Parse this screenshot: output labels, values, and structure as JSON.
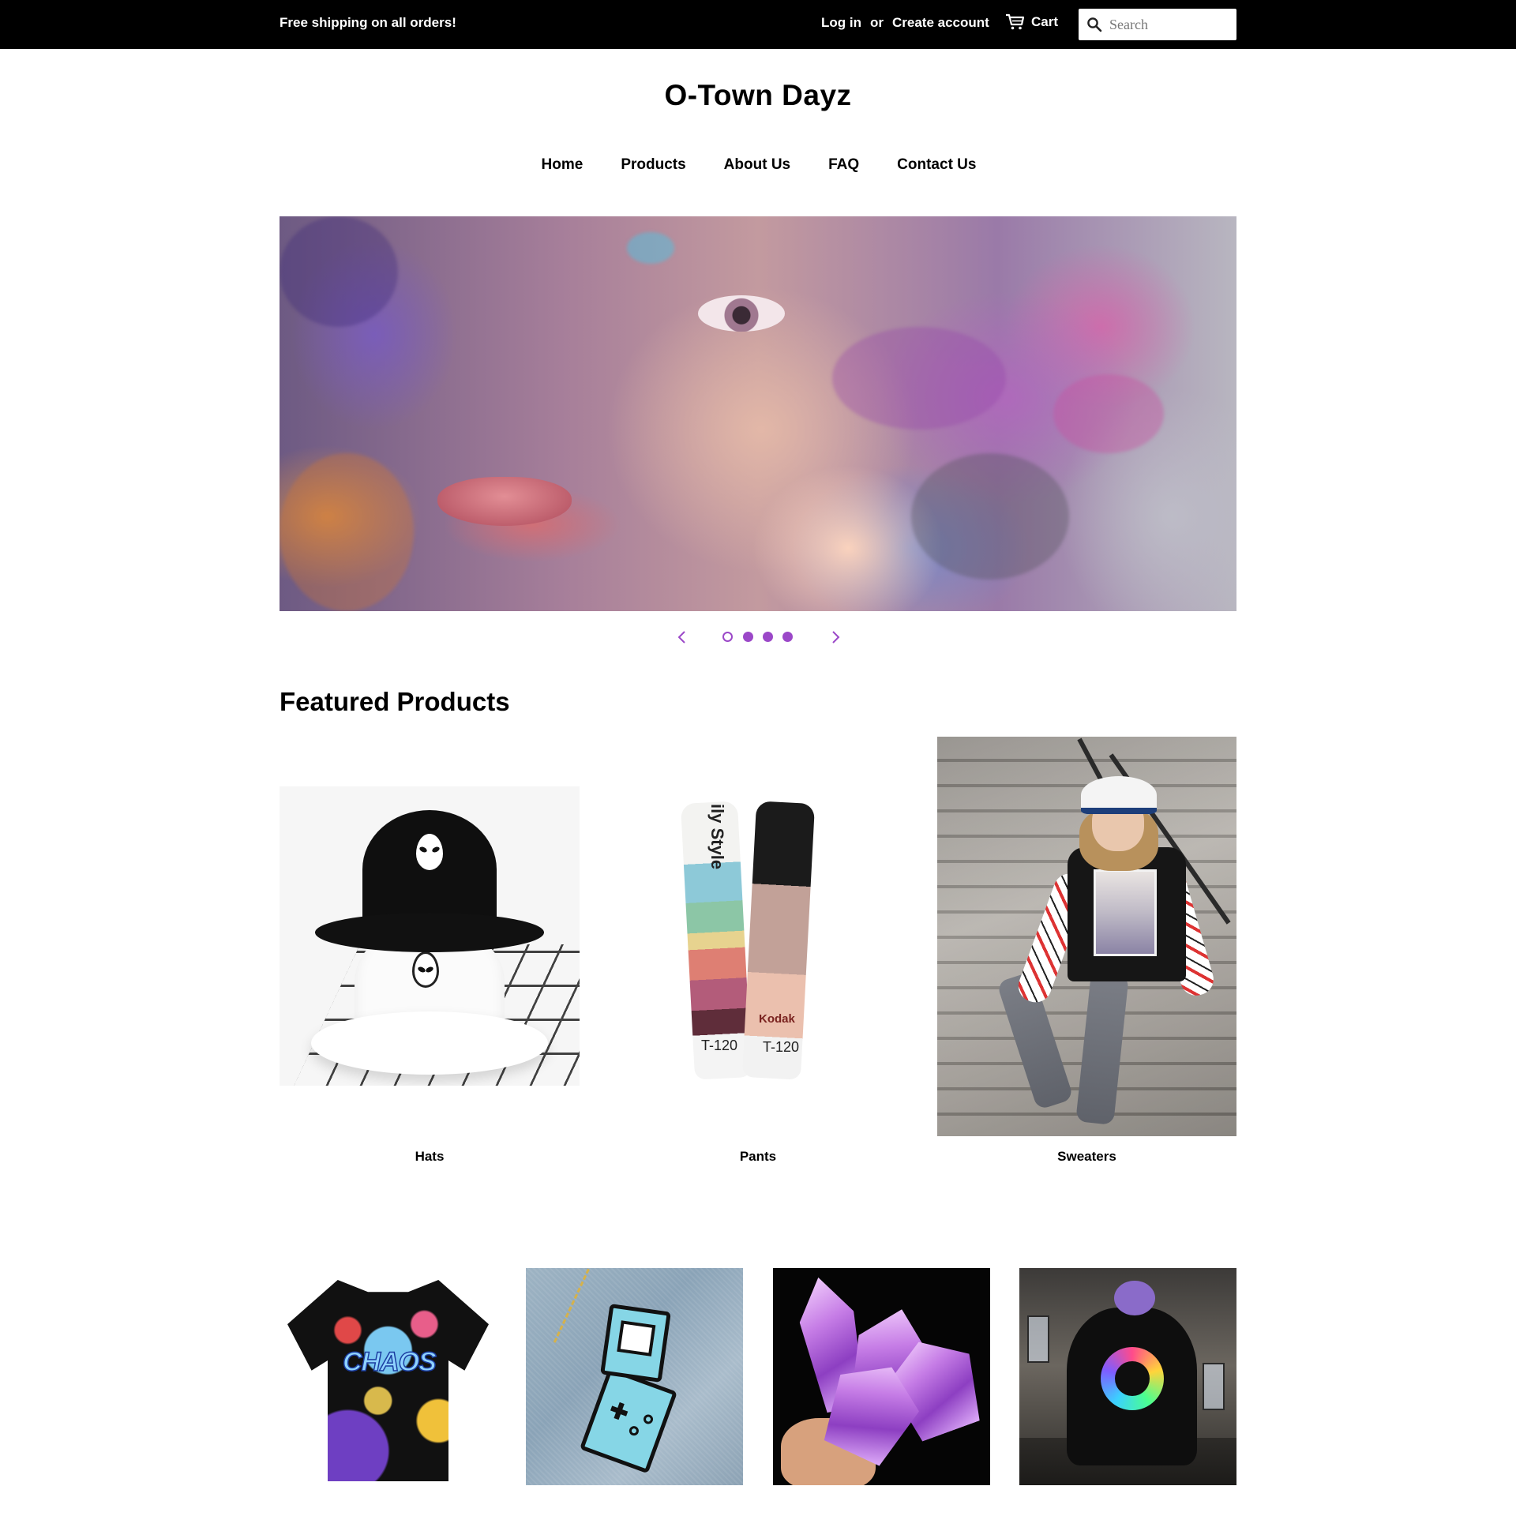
{
  "topbar": {
    "promo": "Free shipping on all orders!",
    "login": "Log in",
    "or": "or",
    "create_account": "Create account",
    "cart": "Cart",
    "search_placeholder": "Search",
    "search_icon": "search-icon",
    "cart_icon": "cart-icon"
  },
  "site": {
    "title": "O-Town Dayz"
  },
  "nav": [
    "Home",
    "Products",
    "About Us",
    "FAQ",
    "Contact Us"
  ],
  "slideshow": {
    "slide_count": 4,
    "active_slide": 1,
    "accent_color": "#9b48c8",
    "prev_icon": "chevron-left-icon",
    "next_icon": "chevron-right-icon"
  },
  "featured": {
    "title": "Featured Products",
    "top_row": [
      {
        "label": "Hats"
      },
      {
        "label": "Pants"
      },
      {
        "label": "Sweaters"
      }
    ],
    "pants_print": {
      "style_text": "ily Style",
      "brand_text": "Kodak",
      "tag_left": "T-120",
      "tag_right": "T-120"
    },
    "shirt_print": "CHAOS"
  },
  "colors": {
    "topbar_bg": "#000000",
    "topbar_text": "#ffffff",
    "text": "#000000"
  }
}
